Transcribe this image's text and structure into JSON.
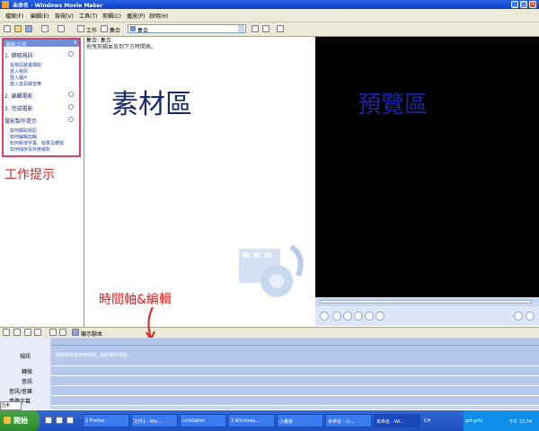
{
  "window": {
    "title": "未命名 - Windows Movie Maker"
  },
  "menu": [
    "檔案(F)",
    "編輯(E)",
    "檢視(V)",
    "工具(T)",
    "剪輯(C)",
    "播放(P)",
    "說明(H)"
  ],
  "toolbar": {
    "tasks_label": "工作",
    "collections_label": "集合",
    "collection_value": "集合"
  },
  "task_pane": {
    "header": "電影工作",
    "sections": [
      {
        "label": "1. 擷取視訊",
        "links": [
          "從視訊裝置擷取",
          "匯入視訊",
          "匯入圖片",
          "匯入音訊或音樂"
        ]
      },
      {
        "label": "2. 編輯電影",
        "links": []
      },
      {
        "label": "3. 完成電影",
        "links": []
      },
      {
        "label": "電影製作提示",
        "links": [
          "如何擷取視訊",
          "如何編輯剪輯",
          "如何新增字幕、效果及轉換",
          "如何儲存及共用電影"
        ]
      }
    ],
    "annotation": "工作提示"
  },
  "collection": {
    "label": "集合: 集合",
    "hint": "拖曳剪輯並放到下方時間表。",
    "annotation": "素材區"
  },
  "preview": {
    "annotation": "預覽區"
  },
  "timeline": {
    "annotation": "時間軸&編輯",
    "show_storyboard_label": "顯示腳本",
    "rows": [
      "視訊",
      "轉換",
      "音訊",
      "音訊/音樂",
      "重疊字幕"
    ],
    "video_hint": "將媒體拖曳到時間表，開始製作電影。"
  },
  "taskbar": {
    "start_label": "開始",
    "tasks": [
      "2 Firefox",
      "文件1 - Mic...",
      "LinkDaten",
      "2 Windows...",
      "小畫家",
      "未命名 - 小...",
      "未命名 - Wi..."
    ],
    "tray_items": [
      "CH",
      "gzf.gzfz",
      "下午 12:34"
    ]
  },
  "language_bar": "力半"
}
